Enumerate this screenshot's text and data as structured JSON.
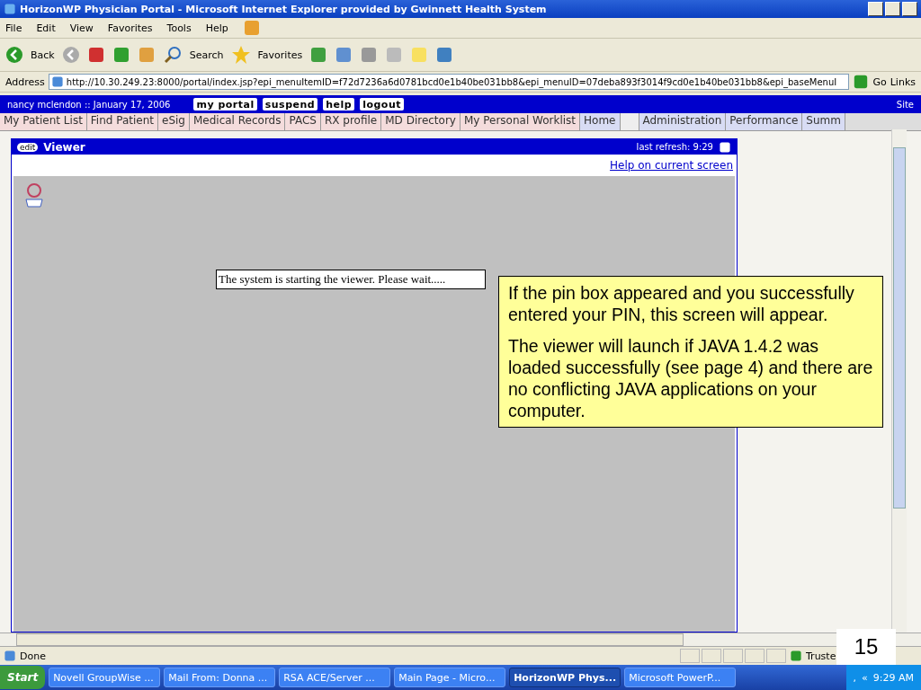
{
  "window": {
    "title": "HorizonWP Physician Portal - Microsoft Internet Explorer provided by Gwinnett Health System"
  },
  "menu": [
    "File",
    "Edit",
    "View",
    "Favorites",
    "Tools",
    "Help"
  ],
  "toolbar": {
    "back": "Back",
    "search": "Search",
    "favorites": "Favorites"
  },
  "address": {
    "label": "Address",
    "value": "http://10.30.249.23:8000/portal/index.jsp?epi_menuItemID=f72d7236a6d0781bcd0e1b40be031bb8&epi_menuID=07deba893f3014f9cd0e1b40be031bb8&epi_baseMenuI",
    "go": "Go",
    "links": "Links"
  },
  "portal": {
    "user": "nancy mclendon :: January 17, 2006",
    "buttons": [
      "my portal",
      "suspend",
      "help",
      "logout"
    ],
    "site": "Site"
  },
  "tabs": [
    {
      "label": "My Patient List",
      "color": "#f4dcdc"
    },
    {
      "label": "Find Patient",
      "color": "#f4dcdc"
    },
    {
      "label": "eSig",
      "color": "#f4dcdc"
    },
    {
      "label": "Medical Records",
      "color": "#f4dcdc"
    },
    {
      "label": "PACS",
      "color": "#f4dcdc"
    },
    {
      "label": "RX profile",
      "color": "#f4dcdc"
    },
    {
      "label": "MD Directory",
      "color": "#f4dcdc"
    },
    {
      "label": "My Personal Worklist",
      "color": "#f4dcdc"
    },
    {
      "label": "Home",
      "color": "#d8dcf4"
    },
    {
      "label": "Administration",
      "color": "#d8dcf4"
    },
    {
      "label": "Performance",
      "color": "#d8dcf4"
    },
    {
      "label": "Summ",
      "color": "#d8dcf4"
    }
  ],
  "viewer": {
    "edit": "edit",
    "title": "Viewer",
    "refresh": "last refresh: 9:29",
    "help_link": "Help on current screen",
    "message": "The system is starting the viewer. Please wait....."
  },
  "callout": [
    "If the pin box appeared and you successfully entered your PIN, this screen will appear.",
    "The viewer will launch if JAVA 1.4.2 was loaded successfully (see page 4) and there are no conflicting JAVA applications on your computer."
  ],
  "slide_number": "15",
  "status_bar": {
    "text": "Done",
    "zone": "Truste"
  },
  "taskbar": {
    "start": "Start",
    "items": [
      {
        "label": "Novell GroupWise ...",
        "selected": false
      },
      {
        "label": "Mail From: Donna ...",
        "selected": false
      },
      {
        "label": "RSA ACE/Server  ...",
        "selected": false
      },
      {
        "label": "Main Page - Micro...",
        "selected": false
      },
      {
        "label": "HorizonWP Phys...",
        "selected": true
      },
      {
        "label": "Microsoft PowerP...",
        "selected": false
      }
    ],
    "tray_sep": ",",
    "chevron": "«",
    "clock": "9:29 AM"
  }
}
